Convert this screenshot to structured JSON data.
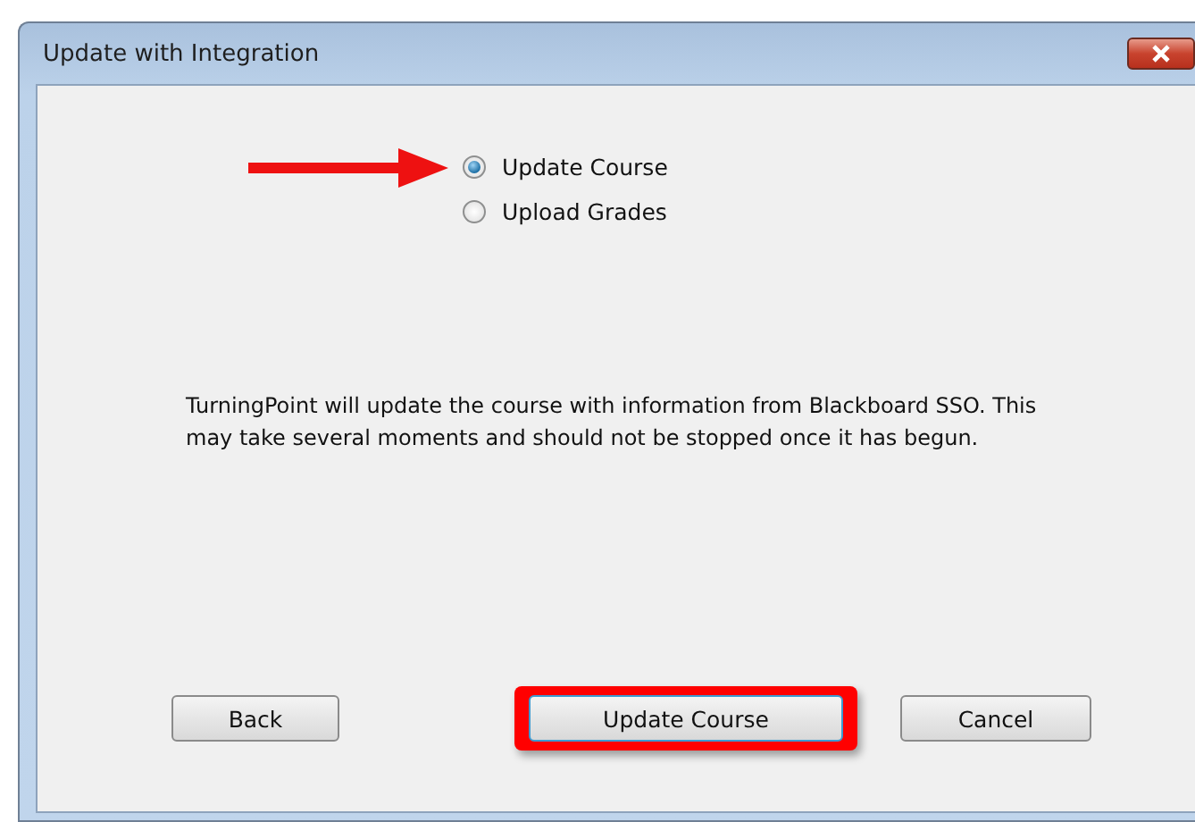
{
  "window": {
    "title": "Update with Integration"
  },
  "options": [
    {
      "label": "Update Course",
      "selected": true,
      "pointed": true
    },
    {
      "label": "Upload Grades",
      "selected": false,
      "pointed": false
    }
  ],
  "message": "TurningPoint will update the course with information from Blackboard SSO. This may take several moments and should not be stopped once it has begun.",
  "buttons": [
    {
      "label": "Back",
      "highlighted": false,
      "focused": false
    },
    {
      "label": "Update Course",
      "highlighted": true,
      "focused": true
    },
    {
      "label": "Cancel",
      "highlighted": false,
      "focused": false
    }
  ]
}
